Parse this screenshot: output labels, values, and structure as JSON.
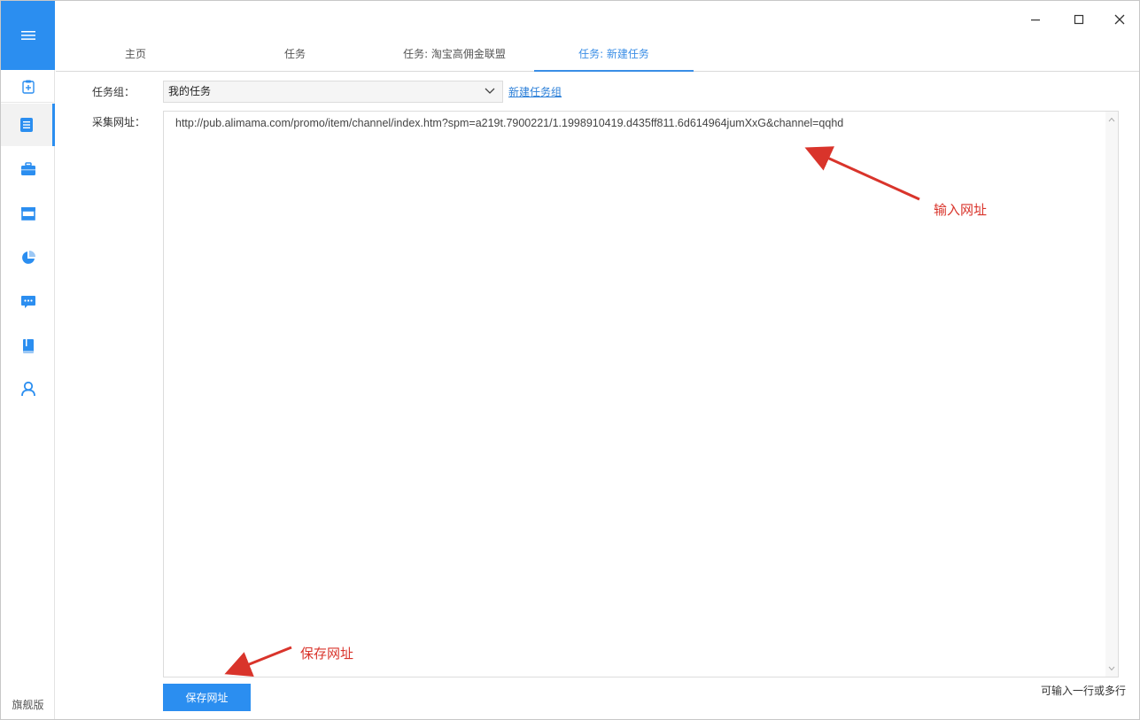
{
  "sidebar": {
    "edition_label": "旗舰版",
    "items": [
      {
        "icon": "clipboard-icon"
      },
      {
        "icon": "document-icon"
      },
      {
        "icon": "briefcase-icon"
      },
      {
        "icon": "store-icon"
      },
      {
        "icon": "pie-chart-icon"
      },
      {
        "icon": "message-icon"
      },
      {
        "icon": "book-icon"
      },
      {
        "icon": "user-icon"
      }
    ],
    "accent": "#2b8ef0"
  },
  "tabs": [
    {
      "label": "主页"
    },
    {
      "label": "任务"
    },
    {
      "label": "任务: 淘宝高佣金联盟"
    },
    {
      "label": "任务: 新建任务",
      "active": true
    }
  ],
  "form": {
    "task_group_label": "任务组：",
    "task_group_value": "我的任务",
    "new_group_link": "新建任务组",
    "url_label": "采集网址：",
    "url_value": "http://pub.alimama.com/promo/item/channel/index.htm?spm=a219t.7900221/1.1998910419.d435ff811.6d614964jumXxG&channel=qqhd",
    "save_button": "保存网址",
    "hint": "可输入一行或多行"
  },
  "annotations": {
    "input_url": "输入网址",
    "save_url": "保存网址",
    "color": "#d9342b"
  }
}
